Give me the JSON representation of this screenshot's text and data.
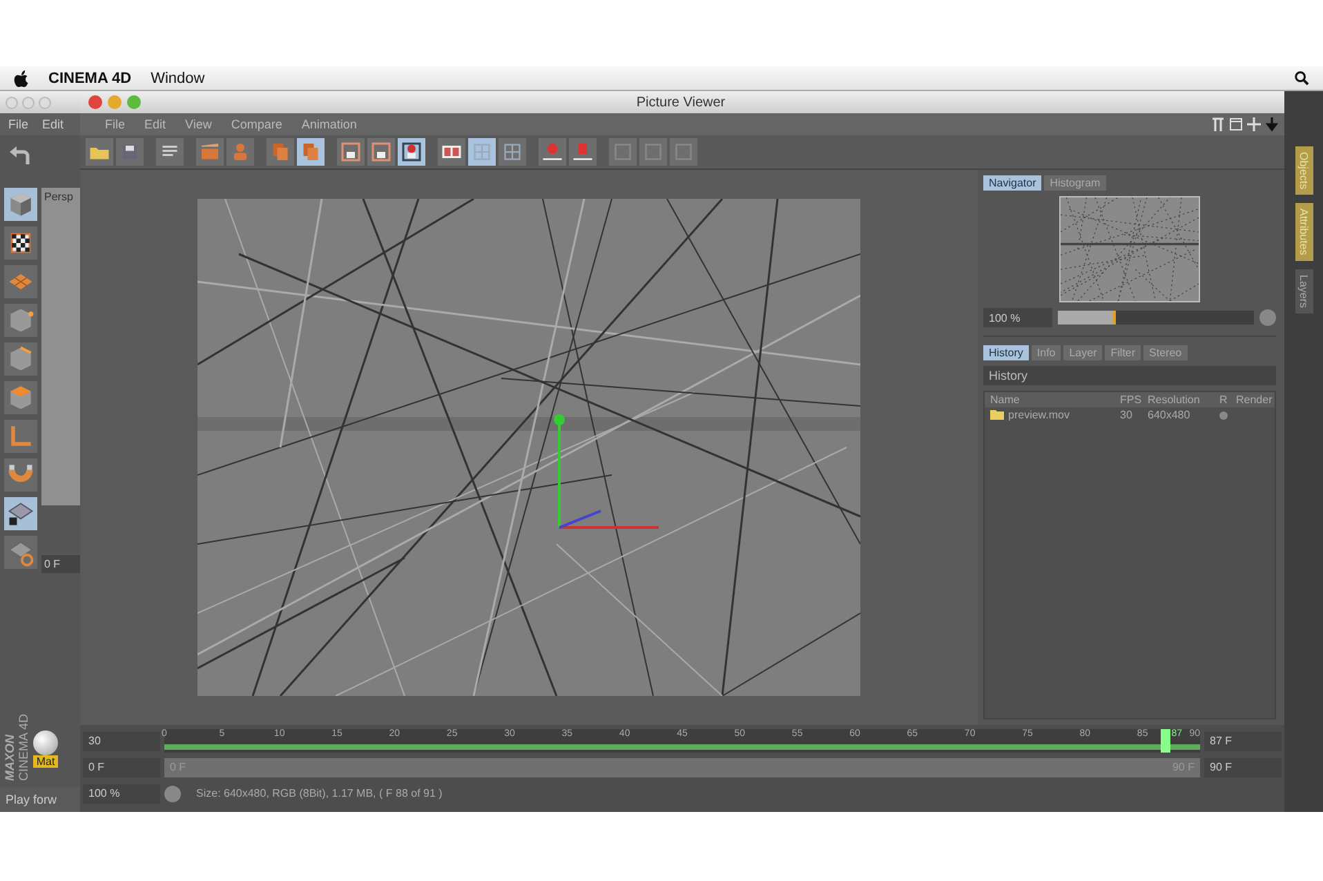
{
  "menubar": {
    "app": "CINEMA 4D",
    "items": [
      "Window"
    ]
  },
  "background_app": {
    "menu": [
      "File",
      "Edit"
    ],
    "viewport_label": "Persp",
    "frame_field": "0 F",
    "material": "Mat",
    "logo_brand": "MAXON",
    "logo_product": "CINEMA 4D",
    "status": "Play forw",
    "tools": [
      {
        "kind": "cube",
        "selected": true
      },
      {
        "kind": "checker",
        "selected": false
      },
      {
        "kind": "plane",
        "selected": false
      },
      {
        "kind": "cube-point",
        "selected": false
      },
      {
        "kind": "cube-edge",
        "selected": false
      },
      {
        "kind": "cube-face",
        "selected": false
      },
      {
        "kind": "axis",
        "selected": false
      },
      {
        "kind": "magnet",
        "selected": false
      },
      {
        "kind": "grid-lock",
        "selected": true
      },
      {
        "kind": "grid-gear",
        "selected": false
      }
    ]
  },
  "window": {
    "title": "Picture Viewer",
    "menu": [
      "File",
      "Edit",
      "View",
      "Compare",
      "Animation"
    ]
  },
  "toolbar": [
    {
      "kind": "folder",
      "selected": false
    },
    {
      "kind": "save",
      "selected": false
    },
    {
      "kind": "list",
      "selected": false
    },
    {
      "kind": "render",
      "selected": false
    },
    {
      "kind": "render-alt",
      "selected": false
    },
    {
      "kind": "copy",
      "selected": false
    },
    {
      "kind": "copy",
      "selected": true
    },
    {
      "kind": "frame",
      "selected": false
    },
    {
      "kind": "frame",
      "selected": false
    },
    {
      "kind": "frame-red",
      "selected": true
    },
    {
      "kind": "film",
      "selected": false
    },
    {
      "kind": "grid",
      "selected": true
    },
    {
      "kind": "grid",
      "selected": false
    },
    {
      "kind": "marker-a",
      "selected": false
    },
    {
      "kind": "marker-b",
      "selected": false
    },
    {
      "kind": "disabled",
      "selected": false
    },
    {
      "kind": "disabled",
      "selected": false
    },
    {
      "kind": "disabled",
      "selected": false
    }
  ],
  "navigator": {
    "tabs": [
      {
        "label": "Navigator",
        "selected": true
      },
      {
        "label": "Histogram",
        "selected": false
      }
    ],
    "zoom": "100 %",
    "zoom_slider": {
      "level": 0.28
    }
  },
  "history": {
    "tabs": [
      {
        "label": "History",
        "selected": true
      },
      {
        "label": "Info",
        "selected": false
      },
      {
        "label": "Layer",
        "selected": false
      },
      {
        "label": "Filter",
        "selected": false
      },
      {
        "label": "Stereo",
        "selected": false
      }
    ],
    "title": "History",
    "columns": [
      "Name",
      "FPS",
      "Resolution",
      "R",
      "Render"
    ],
    "rows": [
      {
        "name": "preview.mov",
        "fps": "30",
        "resolution": "640x480"
      }
    ]
  },
  "timeline": {
    "fps_field": "30",
    "ticks": [
      "0",
      "5",
      "10",
      "15",
      "20",
      "25",
      "30",
      "35",
      "40",
      "45",
      "50",
      "55",
      "60",
      "65",
      "70",
      "75",
      "80",
      "85",
      "90"
    ],
    "playhead": {
      "label": "87",
      "level": 0.967
    },
    "frame_field": "87 F",
    "start_field": "0 F",
    "range": {
      "level": 1
    },
    "range_start": "0 F",
    "range_end": "90 F",
    "end_field": "90 F",
    "zoom_field": "100 %",
    "status": "Size: 640x480, RGB (8Bit), 1.17 MB, ( F 88 of 91 )"
  },
  "side_tabs": [
    {
      "label": "Objects",
      "selected": true
    },
    {
      "label": "Attributes",
      "selected": true
    },
    {
      "label": "Layers",
      "selected": false
    }
  ]
}
